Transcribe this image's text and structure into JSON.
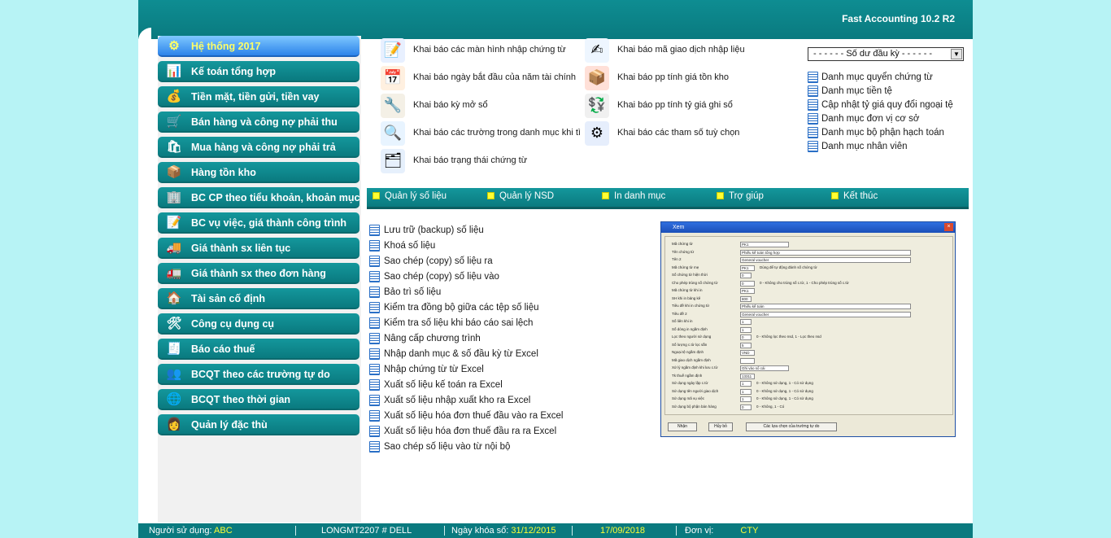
{
  "app": {
    "title": "Fast Accounting 10.2 R2"
  },
  "left_menu": [
    {
      "label": "Hệ thống 2017",
      "icon": "system-gear-icon",
      "glyph": "⚙",
      "active": true
    },
    {
      "label": "Kế toán tổng hợp",
      "icon": "ledger-chart-icon",
      "glyph": "📊"
    },
    {
      "label": "Tiền mặt, tiền gửi, tiền vay",
      "icon": "money-icon",
      "glyph": "💰"
    },
    {
      "label": "Bán hàng và công nợ phải thu",
      "icon": "sales-icon",
      "glyph": "🛒"
    },
    {
      "label": "Mua hàng và công nợ phải trả",
      "icon": "purchase-cart-icon",
      "glyph": "🛍"
    },
    {
      "label": "Hàng tồn kho",
      "icon": "warehouse-icon",
      "glyph": "📦"
    },
    {
      "label": "BC CP theo tiểu khoản, khoản mục",
      "icon": "building-report-icon",
      "glyph": "🏢"
    },
    {
      "label": "BC vụ việc, giá thành công trình",
      "icon": "project-report-icon",
      "glyph": "📝"
    },
    {
      "label": "Giá thành sx liên tục",
      "icon": "production-truck-icon",
      "glyph": "🚚"
    },
    {
      "label": "Giá thành sx theo đơn hàng",
      "icon": "order-truck-icon",
      "glyph": "🚛"
    },
    {
      "label": "Tài sản cố định",
      "icon": "house-icon",
      "glyph": "🏠"
    },
    {
      "label": "Công cụ dụng cụ",
      "icon": "tools-icon",
      "glyph": "🛠"
    },
    {
      "label": "Báo cáo thuế",
      "icon": "tax-report-icon",
      "glyph": "🧾"
    },
    {
      "label": "BCQT theo các trường tự do",
      "icon": "people-report-icon",
      "glyph": "👥"
    },
    {
      "label": "BCQT theo thời gian",
      "icon": "globe-clock-icon",
      "glyph": "🌐"
    },
    {
      "label": "Quản lý đặc thù",
      "icon": "manager-person-icon",
      "glyph": "👩"
    }
  ],
  "tiles": [
    {
      "label": "Khai báo các màn hình nhập chứng từ",
      "icon": "form-edit-icon",
      "glyph": "📝",
      "color": "#e8f0ff"
    },
    {
      "label": "Khai báo mã giao dịch nhập liệu",
      "icon": "transaction-edit-icon",
      "glyph": "✍",
      "color": "#eef6ff"
    },
    {
      "label": "Khai báo ngày bắt đầu của năm tài chính",
      "icon": "calendar-icon",
      "glyph": "📅",
      "color": "#fff0e0"
    },
    {
      "label": "Khai báo pp tính giá tồn kho",
      "icon": "inventory-boxes-icon",
      "glyph": "📦",
      "color": "#ffe0d8"
    },
    {
      "label": "Khai báo kỳ mở sổ",
      "icon": "wrench-icon",
      "glyph": "🔧",
      "color": "#f4f0e6"
    },
    {
      "label": "Khai báo pp tính tỷ giá ghi sổ",
      "icon": "exchange-rate-icon",
      "glyph": "💱",
      "color": "#f0f0f0"
    },
    {
      "label": "Khai báo các trường trong danh mục khi tì",
      "icon": "magnifier-icon",
      "glyph": "🔍",
      "color": "#e8f4ff"
    },
    {
      "label": "Khai báo các tham số tuỳ chọn",
      "icon": "gears-icon",
      "glyph": "⚙",
      "color": "#e6eefc"
    },
    {
      "label": "Khai báo trạng thái chứng từ",
      "icon": "document-stack-icon",
      "glyph": "🗂",
      "color": "#e6f0fc"
    }
  ],
  "opening_balance": {
    "label": "- - - - - -  Số dư đầu kỳ - - - - - -"
  },
  "catalogs": [
    "Danh mục quyển chứng từ",
    "Danh mục tiền tệ",
    "Cập nhật tỷ giá quy đổi ngoại tệ",
    "Danh mục đơn vị cơ sở",
    "Danh mục bộ phận hạch toán",
    "Danh mục nhân viên"
  ],
  "tabs": [
    "Quản lý số liệu",
    "Quản lý NSD",
    "In danh mục",
    "Trợ giúp",
    "Kết thúc"
  ],
  "tasks": [
    "Lưu trữ (backup) số liệu",
    "Khoá số liệu",
    "Sao chép (copy) số liệu ra",
    "Sao chép (copy) số liệu vào",
    "Bảo trì số liệu",
    "Kiểm tra đồng bộ giữa các tệp số liệu",
    "Kiểm tra số liệu khi báo cáo sai lệch",
    "Nâng cấp chương trình",
    "Nhập danh mục & số đầu kỳ từ Excel",
    "Nhập chứng từ từ Excel",
    "Xuất số liệu kế toán ra Excel",
    "Xuất số liệu nhập xuất kho ra Excel",
    "Xuất số liệu hóa đơn thuế đầu vào ra Excel",
    "Xuất số liệu hóa đơn thuế đầu ra ra Excel",
    "Sao chép số liệu vào từ nội bộ"
  ],
  "preview": {
    "title": "Xem",
    "rows": [
      {
        "label": "Mã chứng từ",
        "value": "PK1",
        "note": ""
      },
      {
        "label": "Tên chứng từ",
        "value": "Phiếu kế toán tổng hợp",
        "note": ""
      },
      {
        "label": "Tên 2",
        "value": "General voucher",
        "note": ""
      },
      {
        "label": "Mã chứng từ mẹ",
        "value": "PK1",
        "note": "Dùng để tự động đánh số chứng từ"
      },
      {
        "label": "Số chứng từ hiện thời",
        "value": "0",
        "note": ""
      },
      {
        "label": "Cho phép trùng số chứng từ",
        "value": "0",
        "note": "0 - Không cho trùng số c.từ, 1 - Cho phép trùng số c.từ"
      },
      {
        "label": "Mã chứng từ khi in",
        "value": "PK1",
        "note": ""
      },
      {
        "label": "SH khi in bảng kê",
        "value": "800",
        "note": ""
      },
      {
        "label": "Tiêu đề khi in chứng từ",
        "value": "Phiếu kế toán",
        "note": ""
      },
      {
        "label": "Tiêu đề 2",
        "value": "General voucher",
        "note": ""
      },
      {
        "label": "Số liên khi in",
        "value": "1",
        "note": ""
      },
      {
        "label": "Số dòng in ngầm định",
        "value": "1",
        "note": ""
      },
      {
        "label": "Lọc theo người sử dụng",
        "value": "0",
        "note": "0 - Không lọc theo nsd, 1 - Lọc theo nsd"
      },
      {
        "label": "Số lượng c.từ lọc sẵn",
        "value": "5",
        "note": ""
      },
      {
        "label": "Ngoại tệ ngầm định",
        "value": "VND",
        "note": ""
      },
      {
        "label": "Mã giao dịch ngầm định",
        "value": "",
        "note": ""
      },
      {
        "label": "Xử lý ngầm định khi lưu c.từ",
        "value": "Ghi vào sổ cái",
        "note": ""
      },
      {
        "label": "Tk thuế ngầm định",
        "value": "13311",
        "note": ""
      },
      {
        "label": "Sử dụng ngày lập c.từ",
        "value": "1",
        "note": "0 - Không sử dụng, 1 - Có sử dụng"
      },
      {
        "label": "Sử dụng tên người giao dịch",
        "value": "1",
        "note": "0 - Không sử dụng, 1 - Có sử dụng"
      },
      {
        "label": "Sử dụng mã vụ việc",
        "value": "1",
        "note": "0 - Không sử dụng, 1 - Có sử dụng"
      },
      {
        "label": "Sử dụng bộ phận bán hàng",
        "value": "0",
        "note": "0 - Không, 1 - Có"
      }
    ],
    "buttons": [
      "Nhận",
      "Hủy bỏ",
      "Các lựa chọn của trường tự do"
    ]
  },
  "status": {
    "user_label": "Người sử dụng:",
    "user_value": "ABC",
    "machine": "LONGMT2207 # DELL",
    "lock_label": "Ngày khóa sổ:",
    "lock_value": "31/12/2015",
    "date": "17/09/2018",
    "unit_label": "Đơn vị:",
    "unit_value": "CTY"
  }
}
